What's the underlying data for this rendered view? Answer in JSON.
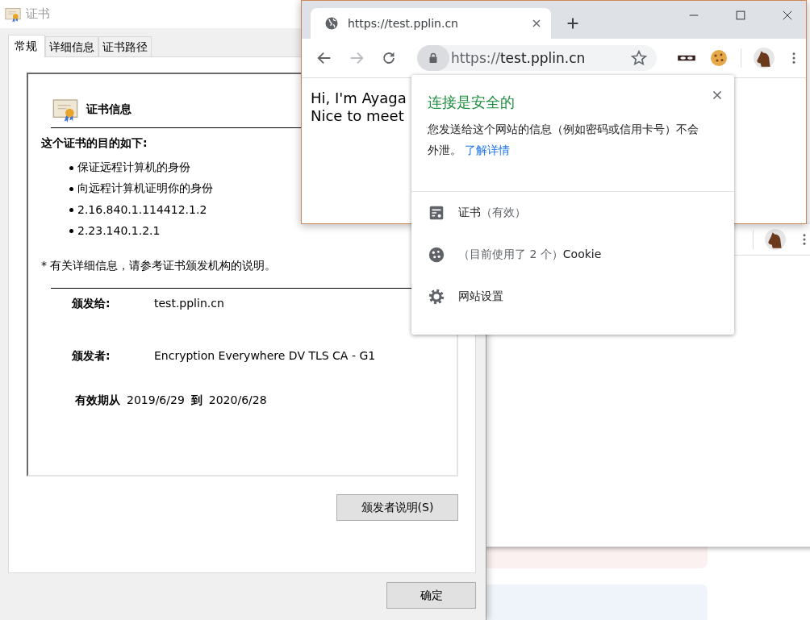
{
  "certificate_dialog": {
    "title": "证书",
    "tabs": [
      {
        "label": "常规",
        "selected": true
      },
      {
        "label": "详细信息",
        "selected": false
      },
      {
        "label": "证书路径",
        "selected": false
      }
    ],
    "heading": "证书信息",
    "purpose_title": "这个证书的目的如下:",
    "purposes": [
      "保证远程计算机的身份",
      "向远程计算机证明你的身份",
      "2.16.840.1.114412.1.2",
      "2.23.140.1.2.1"
    ],
    "note": "* 有关详细信息，请参考证书颁发机构的说明。",
    "fields": [
      {
        "label": "颁发给:",
        "value": "test.pplin.cn"
      },
      {
        "label": "颁发者:",
        "value": "Encryption Everywhere DV TLS CA - G1"
      }
    ],
    "validity": {
      "from_label": "有效期从",
      "from": "2019/6/29",
      "to_label": "到",
      "to": "2020/6/28"
    },
    "issuer_statement_button": "颁发者说明(S)",
    "ok_button": "确定"
  },
  "browser": {
    "tab_title": "https://test.pplin.cn",
    "forward": {
      "disabled": true
    },
    "security_chip": {
      "active": true
    },
    "address": {
      "scheme": "https://",
      "host": "test.pplin.cn"
    },
    "page_lines": [
      "Hi, I'm Ayaga",
      "Nice to meet"
    ]
  },
  "site_info_popup": {
    "title": "连接是安全的",
    "description": "您发送给这个网站的信息（例如密码或信用卡号）不会外泄。",
    "link": "了解详情",
    "items": [
      {
        "kind": "certificate",
        "label": "证书",
        "detail": "（有效）"
      },
      {
        "kind": "cookies",
        "label": "Cookie",
        "detail": "（目前使用了 2 个）"
      },
      {
        "kind": "settings",
        "label": "网站设置"
      }
    ]
  }
}
